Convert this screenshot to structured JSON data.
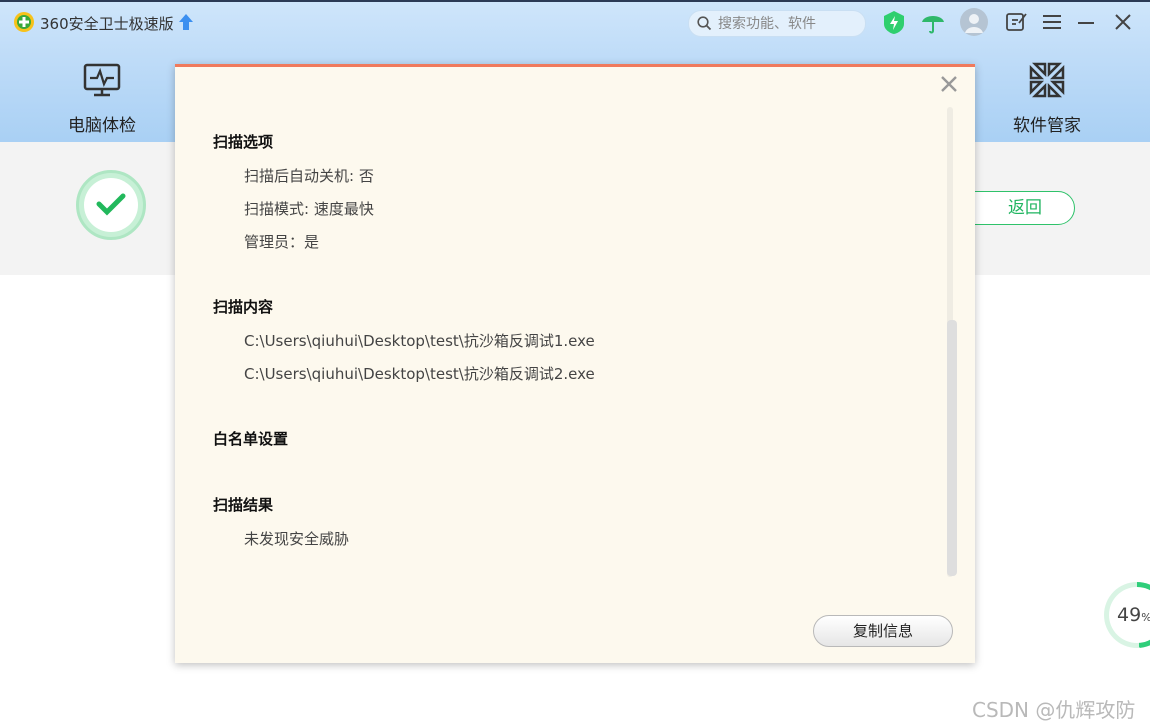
{
  "app": {
    "title": "360安全卫士极速版",
    "search_placeholder": "搜索功能、软件"
  },
  "nav": {
    "left_label": "电脑体检",
    "right_label": "软件管家"
  },
  "status": {
    "back_label": "返回",
    "progress_value": "49",
    "progress_unit": "%"
  },
  "dialog": {
    "sections": {
      "scan_options": {
        "title": "扫描选项",
        "items": [
          "扫描后自动关机: 否",
          "扫描模式: 速度最快",
          "管理员：是"
        ]
      },
      "scan_content": {
        "title": "扫描内容",
        "items": [
          "C:\\Users\\qiuhui\\Desktop\\test\\抗沙箱反调试1.exe",
          "C:\\Users\\qiuhui\\Desktop\\test\\抗沙箱反调试2.exe"
        ]
      },
      "whitelist": {
        "title": "白名单设置"
      },
      "scan_result": {
        "title": "扫描结果",
        "items": [
          "未发现安全威胁"
        ]
      }
    },
    "copy_label": "复制信息"
  },
  "watermark": "CSDN @仇辉攻防",
  "colors": {
    "accent_green": "#20b560",
    "dialog_border": "#f07a5c",
    "dialog_bg": "#fdf9ee",
    "header_blue": "#bfdcf8"
  }
}
